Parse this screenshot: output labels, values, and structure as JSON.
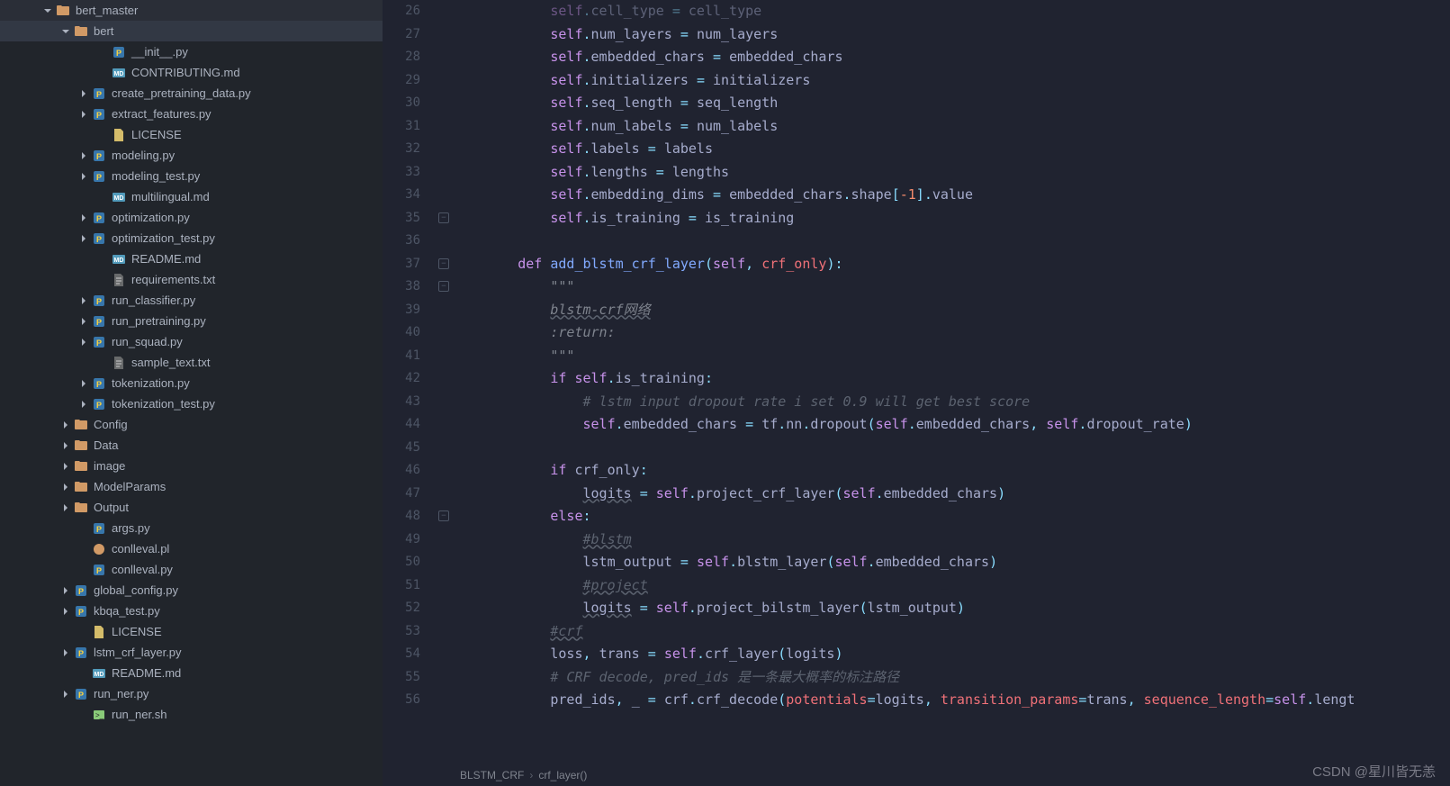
{
  "sidebar": {
    "items": [
      {
        "indent": 46,
        "chev": "down",
        "icon": "folder",
        "label": "bert_master"
      },
      {
        "indent": 66,
        "chev": "down",
        "icon": "folder",
        "label": "bert",
        "selected": true
      },
      {
        "indent": 108,
        "chev": "",
        "icon": "py",
        "label": "__init__.py"
      },
      {
        "indent": 108,
        "chev": "",
        "icon": "md",
        "label": "CONTRIBUTING.md"
      },
      {
        "indent": 86,
        "chev": "right",
        "icon": "py",
        "label": "create_pretraining_data.py"
      },
      {
        "indent": 86,
        "chev": "right",
        "icon": "py",
        "label": "extract_features.py"
      },
      {
        "indent": 108,
        "chev": "",
        "icon": "lic",
        "label": "LICENSE"
      },
      {
        "indent": 86,
        "chev": "right",
        "icon": "py",
        "label": "modeling.py"
      },
      {
        "indent": 86,
        "chev": "right",
        "icon": "py",
        "label": "modeling_test.py"
      },
      {
        "indent": 108,
        "chev": "",
        "icon": "md",
        "label": "multilingual.md"
      },
      {
        "indent": 86,
        "chev": "right",
        "icon": "py",
        "label": "optimization.py"
      },
      {
        "indent": 86,
        "chev": "right",
        "icon": "py",
        "label": "optimization_test.py"
      },
      {
        "indent": 108,
        "chev": "",
        "icon": "md",
        "label": "README.md"
      },
      {
        "indent": 108,
        "chev": "",
        "icon": "txt",
        "label": "requirements.txt"
      },
      {
        "indent": 86,
        "chev": "right",
        "icon": "py",
        "label": "run_classifier.py"
      },
      {
        "indent": 86,
        "chev": "right",
        "icon": "py",
        "label": "run_pretraining.py"
      },
      {
        "indent": 86,
        "chev": "right",
        "icon": "py",
        "label": "run_squad.py"
      },
      {
        "indent": 108,
        "chev": "",
        "icon": "txt",
        "label": "sample_text.txt"
      },
      {
        "indent": 86,
        "chev": "right",
        "icon": "py",
        "label": "tokenization.py"
      },
      {
        "indent": 86,
        "chev": "right",
        "icon": "py",
        "label": "tokenization_test.py"
      },
      {
        "indent": 66,
        "chev": "right",
        "icon": "folder",
        "label": "Config"
      },
      {
        "indent": 66,
        "chev": "right",
        "icon": "folder",
        "label": "Data"
      },
      {
        "indent": 66,
        "chev": "right",
        "icon": "folder",
        "label": "image"
      },
      {
        "indent": 66,
        "chev": "right",
        "icon": "folder",
        "label": "ModelParams"
      },
      {
        "indent": 66,
        "chev": "right",
        "icon": "folder",
        "label": "Output"
      },
      {
        "indent": 86,
        "chev": "",
        "icon": "py",
        "label": "args.py"
      },
      {
        "indent": 86,
        "chev": "",
        "icon": "pl",
        "label": "conlleval.pl"
      },
      {
        "indent": 86,
        "chev": "",
        "icon": "py",
        "label": "conlleval.py"
      },
      {
        "indent": 66,
        "chev": "right",
        "icon": "py",
        "label": "global_config.py"
      },
      {
        "indent": 66,
        "chev": "right",
        "icon": "py",
        "label": "kbqa_test.py"
      },
      {
        "indent": 86,
        "chev": "",
        "icon": "lic",
        "label": "LICENSE"
      },
      {
        "indent": 66,
        "chev": "right",
        "icon": "py",
        "label": "lstm_crf_layer.py"
      },
      {
        "indent": 86,
        "chev": "",
        "icon": "md",
        "label": "README.md"
      },
      {
        "indent": 66,
        "chev": "right",
        "icon": "py",
        "label": "run_ner.py"
      },
      {
        "indent": 86,
        "chev": "",
        "icon": "sh",
        "label": "run_ner.sh"
      }
    ]
  },
  "gutter": [
    "26",
    "27",
    "28",
    "29",
    "30",
    "31",
    "32",
    "33",
    "34",
    "35",
    "36",
    "37",
    "38",
    "39",
    "40",
    "41",
    "42",
    "43",
    "44",
    "45",
    "46",
    "47",
    "48",
    "49",
    "50",
    "51",
    "52",
    "53",
    "54",
    "55",
    "56"
  ],
  "fold_marks": [
    {
      "line": 9,
      "kind": "minus"
    },
    {
      "line": 11,
      "kind": "minus"
    },
    {
      "line": 12,
      "kind": "minus"
    },
    {
      "line": 22,
      "kind": "minus"
    }
  ],
  "code": {
    "lines": [
      [
        {
          "c": "self",
          "t": "self"
        },
        {
          "c": ".",
          "t": "op"
        },
        {
          "c": "cell_type ",
          "t": "id"
        },
        {
          "c": "= ",
          "t": "op"
        },
        {
          "c": "cell_type",
          "t": "id"
        }
      ],
      [
        {
          "c": "self",
          "t": "self"
        },
        {
          "c": ".",
          "t": "op"
        },
        {
          "c": "num_layers ",
          "t": "id"
        },
        {
          "c": "= ",
          "t": "op"
        },
        {
          "c": "num_layers",
          "t": "id"
        }
      ],
      [
        {
          "c": "self",
          "t": "self"
        },
        {
          "c": ".",
          "t": "op"
        },
        {
          "c": "embedded_chars ",
          "t": "id"
        },
        {
          "c": "= ",
          "t": "op"
        },
        {
          "c": "embedded_chars",
          "t": "id"
        }
      ],
      [
        {
          "c": "self",
          "t": "self"
        },
        {
          "c": ".",
          "t": "op"
        },
        {
          "c": "initializers ",
          "t": "id"
        },
        {
          "c": "= ",
          "t": "op"
        },
        {
          "c": "initializers",
          "t": "id"
        }
      ],
      [
        {
          "c": "self",
          "t": "self"
        },
        {
          "c": ".",
          "t": "op"
        },
        {
          "c": "seq_length ",
          "t": "id"
        },
        {
          "c": "= ",
          "t": "op"
        },
        {
          "c": "seq_length",
          "t": "id"
        }
      ],
      [
        {
          "c": "self",
          "t": "self"
        },
        {
          "c": ".",
          "t": "op"
        },
        {
          "c": "num_labels ",
          "t": "id"
        },
        {
          "c": "= ",
          "t": "op"
        },
        {
          "c": "num_labels",
          "t": "id"
        }
      ],
      [
        {
          "c": "self",
          "t": "self"
        },
        {
          "c": ".",
          "t": "op"
        },
        {
          "c": "labels ",
          "t": "id"
        },
        {
          "c": "= ",
          "t": "op"
        },
        {
          "c": "labels",
          "t": "id"
        }
      ],
      [
        {
          "c": "self",
          "t": "self"
        },
        {
          "c": ".",
          "t": "op"
        },
        {
          "c": "lengths ",
          "t": "id"
        },
        {
          "c": "= ",
          "t": "op"
        },
        {
          "c": "lengths",
          "t": "id"
        }
      ],
      [
        {
          "c": "self",
          "t": "self"
        },
        {
          "c": ".",
          "t": "op"
        },
        {
          "c": "embedding_dims ",
          "t": "id"
        },
        {
          "c": "= ",
          "t": "op"
        },
        {
          "c": "embedded_chars",
          "t": "id"
        },
        {
          "c": ".",
          "t": "op"
        },
        {
          "c": "shape",
          "t": "id"
        },
        {
          "c": "[",
          "t": "op"
        },
        {
          "c": "-1",
          "t": "num"
        },
        {
          "c": "]",
          "t": "op"
        },
        {
          "c": ".",
          "t": "op"
        },
        {
          "c": "value",
          "t": "id"
        }
      ],
      [
        {
          "c": "self",
          "t": "self"
        },
        {
          "c": ".",
          "t": "op"
        },
        {
          "c": "is_training ",
          "t": "id"
        },
        {
          "c": "= ",
          "t": "op"
        },
        {
          "c": "is_training",
          "t": "id"
        }
      ],
      [],
      [
        {
          "c": "def ",
          "t": "kw"
        },
        {
          "c": "add_blstm_crf_layer",
          "t": "fn"
        },
        {
          "c": "(",
          "t": "op"
        },
        {
          "c": "self",
          "t": "self"
        },
        {
          "c": ", ",
          "t": "op"
        },
        {
          "c": "crf_only",
          "t": "param"
        },
        {
          "c": "):",
          "t": "op"
        }
      ],
      [
        {
          "c": "\"\"\"",
          "t": "str"
        }
      ],
      [
        {
          "c": "blstm-crf网络",
          "t": "str",
          "u": true
        }
      ],
      [
        {
          "c": ":return:",
          "t": "str"
        }
      ],
      [
        {
          "c": "\"\"\"",
          "t": "str"
        }
      ],
      [
        {
          "c": "if ",
          "t": "kw"
        },
        {
          "c": "self",
          "t": "self"
        },
        {
          "c": ".",
          "t": "op"
        },
        {
          "c": "is_training",
          "t": "id"
        },
        {
          "c": ":",
          "t": "op"
        }
      ],
      [
        {
          "c": "# lstm input dropout rate i set 0.9 will get best score",
          "t": "cmt"
        }
      ],
      [
        {
          "c": "self",
          "t": "self"
        },
        {
          "c": ".",
          "t": "op"
        },
        {
          "c": "embedded_chars ",
          "t": "id"
        },
        {
          "c": "= ",
          "t": "op"
        },
        {
          "c": "tf",
          "t": "id"
        },
        {
          "c": ".",
          "t": "op"
        },
        {
          "c": "nn",
          "t": "id"
        },
        {
          "c": ".",
          "t": "op"
        },
        {
          "c": "dropout",
          "t": "id"
        },
        {
          "c": "(",
          "t": "op"
        },
        {
          "c": "self",
          "t": "self"
        },
        {
          "c": ".",
          "t": "op"
        },
        {
          "c": "embedded_chars",
          "t": "id"
        },
        {
          "c": ", ",
          "t": "op"
        },
        {
          "c": "self",
          "t": "self"
        },
        {
          "c": ".",
          "t": "op"
        },
        {
          "c": "dropout_rate",
          "t": "id"
        },
        {
          "c": ")",
          "t": "op"
        }
      ],
      [],
      [
        {
          "c": "if ",
          "t": "kw"
        },
        {
          "c": "crf_only",
          "t": "id"
        },
        {
          "c": ":",
          "t": "op"
        }
      ],
      [
        {
          "c": "logits",
          "t": "id",
          "u": true
        },
        {
          "c": " = ",
          "t": "op"
        },
        {
          "c": "self",
          "t": "self"
        },
        {
          "c": ".",
          "t": "op"
        },
        {
          "c": "project_crf_layer",
          "t": "id"
        },
        {
          "c": "(",
          "t": "op"
        },
        {
          "c": "self",
          "t": "self"
        },
        {
          "c": ".",
          "t": "op"
        },
        {
          "c": "embedded_chars",
          "t": "id"
        },
        {
          "c": ")",
          "t": "op"
        }
      ],
      [
        {
          "c": "else",
          "t": "kw"
        },
        {
          "c": ":",
          "t": "op"
        }
      ],
      [
        {
          "c": "#blstm",
          "t": "cmt",
          "u": true
        }
      ],
      [
        {
          "c": "lstm_output ",
          "t": "id"
        },
        {
          "c": "= ",
          "t": "op"
        },
        {
          "c": "self",
          "t": "self"
        },
        {
          "c": ".",
          "t": "op"
        },
        {
          "c": "blstm_layer",
          "t": "id"
        },
        {
          "c": "(",
          "t": "op"
        },
        {
          "c": "self",
          "t": "self"
        },
        {
          "c": ".",
          "t": "op"
        },
        {
          "c": "embedded_chars",
          "t": "id"
        },
        {
          "c": ")",
          "t": "op"
        }
      ],
      [
        {
          "c": "#project",
          "t": "cmt",
          "u": true
        }
      ],
      [
        {
          "c": "logits",
          "t": "id",
          "u": true
        },
        {
          "c": " = ",
          "t": "op"
        },
        {
          "c": "self",
          "t": "self"
        },
        {
          "c": ".",
          "t": "op"
        },
        {
          "c": "project_bilstm_layer",
          "t": "id"
        },
        {
          "c": "(",
          "t": "op"
        },
        {
          "c": "lstm_output",
          "t": "id"
        },
        {
          "c": ")",
          "t": "op"
        }
      ],
      [
        {
          "c": "#crf",
          "t": "cmt",
          "u": true
        }
      ],
      [
        {
          "c": "loss",
          "t": "id"
        },
        {
          "c": ", ",
          "t": "op"
        },
        {
          "c": "trans ",
          "t": "id"
        },
        {
          "c": "= ",
          "t": "op"
        },
        {
          "c": "self",
          "t": "self"
        },
        {
          "c": ".",
          "t": "op"
        },
        {
          "c": "crf_layer",
          "t": "id"
        },
        {
          "c": "(",
          "t": "op"
        },
        {
          "c": "logits",
          "t": "id"
        },
        {
          "c": ")",
          "t": "op"
        }
      ],
      [
        {
          "c": "# CRF decode, pred_ids 是一条最大概率的标注路径",
          "t": "cmt"
        }
      ],
      [
        {
          "c": "pred_ids",
          "t": "id"
        },
        {
          "c": ", ",
          "t": "op"
        },
        {
          "c": "_ ",
          "t": "id"
        },
        {
          "c": "= ",
          "t": "op"
        },
        {
          "c": "crf",
          "t": "id"
        },
        {
          "c": ".",
          "t": "op"
        },
        {
          "c": "crf_decode",
          "t": "id"
        },
        {
          "c": "(",
          "t": "op"
        },
        {
          "c": "potentials",
          "t": "param"
        },
        {
          "c": "=",
          "t": "op"
        },
        {
          "c": "logits",
          "t": "id"
        },
        {
          "c": ", ",
          "t": "op"
        },
        {
          "c": "transition_params",
          "t": "param"
        },
        {
          "c": "=",
          "t": "op"
        },
        {
          "c": "trans",
          "t": "id"
        },
        {
          "c": ", ",
          "t": "op"
        },
        {
          "c": "sequence_length",
          "t": "param"
        },
        {
          "c": "=",
          "t": "op"
        },
        {
          "c": "self",
          "t": "self"
        },
        {
          "c": ".",
          "t": "op"
        },
        {
          "c": "lengt",
          "t": "id"
        }
      ]
    ],
    "indents": [
      8,
      8,
      8,
      8,
      8,
      8,
      8,
      8,
      8,
      8,
      0,
      4,
      8,
      8,
      8,
      8,
      8,
      12,
      12,
      0,
      8,
      12,
      8,
      12,
      12,
      12,
      12,
      8,
      8,
      8,
      8
    ]
  },
  "breadcrumb": {
    "class": "BLSTM_CRF",
    "method": "crf_layer()"
  },
  "watermark": "CSDN @星川皆无恙"
}
